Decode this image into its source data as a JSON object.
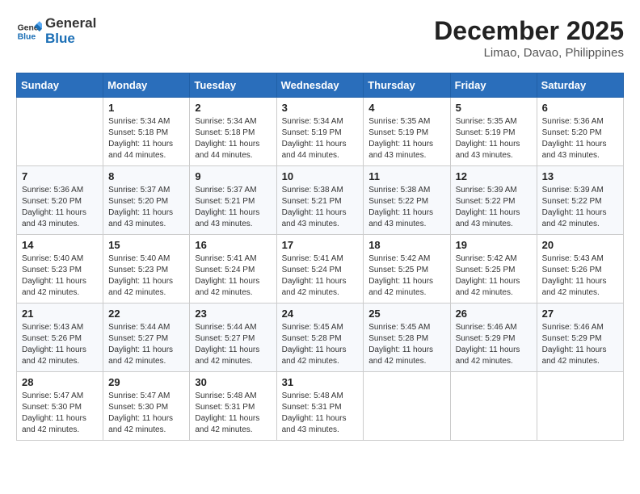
{
  "header": {
    "logo_general": "General",
    "logo_blue": "Blue",
    "month": "December 2025",
    "location": "Limao, Davao, Philippines"
  },
  "days_of_week": [
    "Sunday",
    "Monday",
    "Tuesday",
    "Wednesday",
    "Thursday",
    "Friday",
    "Saturday"
  ],
  "weeks": [
    [
      {
        "day": "",
        "info": ""
      },
      {
        "day": "1",
        "info": "Sunrise: 5:34 AM\nSunset: 5:18 PM\nDaylight: 11 hours\nand 44 minutes."
      },
      {
        "day": "2",
        "info": "Sunrise: 5:34 AM\nSunset: 5:18 PM\nDaylight: 11 hours\nand 44 minutes."
      },
      {
        "day": "3",
        "info": "Sunrise: 5:34 AM\nSunset: 5:19 PM\nDaylight: 11 hours\nand 44 minutes."
      },
      {
        "day": "4",
        "info": "Sunrise: 5:35 AM\nSunset: 5:19 PM\nDaylight: 11 hours\nand 43 minutes."
      },
      {
        "day": "5",
        "info": "Sunrise: 5:35 AM\nSunset: 5:19 PM\nDaylight: 11 hours\nand 43 minutes."
      },
      {
        "day": "6",
        "info": "Sunrise: 5:36 AM\nSunset: 5:20 PM\nDaylight: 11 hours\nand 43 minutes."
      }
    ],
    [
      {
        "day": "7",
        "info": "Sunrise: 5:36 AM\nSunset: 5:20 PM\nDaylight: 11 hours\nand 43 minutes."
      },
      {
        "day": "8",
        "info": "Sunrise: 5:37 AM\nSunset: 5:20 PM\nDaylight: 11 hours\nand 43 minutes."
      },
      {
        "day": "9",
        "info": "Sunrise: 5:37 AM\nSunset: 5:21 PM\nDaylight: 11 hours\nand 43 minutes."
      },
      {
        "day": "10",
        "info": "Sunrise: 5:38 AM\nSunset: 5:21 PM\nDaylight: 11 hours\nand 43 minutes."
      },
      {
        "day": "11",
        "info": "Sunrise: 5:38 AM\nSunset: 5:22 PM\nDaylight: 11 hours\nand 43 minutes."
      },
      {
        "day": "12",
        "info": "Sunrise: 5:39 AM\nSunset: 5:22 PM\nDaylight: 11 hours\nand 43 minutes."
      },
      {
        "day": "13",
        "info": "Sunrise: 5:39 AM\nSunset: 5:22 PM\nDaylight: 11 hours\nand 42 minutes."
      }
    ],
    [
      {
        "day": "14",
        "info": "Sunrise: 5:40 AM\nSunset: 5:23 PM\nDaylight: 11 hours\nand 42 minutes."
      },
      {
        "day": "15",
        "info": "Sunrise: 5:40 AM\nSunset: 5:23 PM\nDaylight: 11 hours\nand 42 minutes."
      },
      {
        "day": "16",
        "info": "Sunrise: 5:41 AM\nSunset: 5:24 PM\nDaylight: 11 hours\nand 42 minutes."
      },
      {
        "day": "17",
        "info": "Sunrise: 5:41 AM\nSunset: 5:24 PM\nDaylight: 11 hours\nand 42 minutes."
      },
      {
        "day": "18",
        "info": "Sunrise: 5:42 AM\nSunset: 5:25 PM\nDaylight: 11 hours\nand 42 minutes."
      },
      {
        "day": "19",
        "info": "Sunrise: 5:42 AM\nSunset: 5:25 PM\nDaylight: 11 hours\nand 42 minutes."
      },
      {
        "day": "20",
        "info": "Sunrise: 5:43 AM\nSunset: 5:26 PM\nDaylight: 11 hours\nand 42 minutes."
      }
    ],
    [
      {
        "day": "21",
        "info": "Sunrise: 5:43 AM\nSunset: 5:26 PM\nDaylight: 11 hours\nand 42 minutes."
      },
      {
        "day": "22",
        "info": "Sunrise: 5:44 AM\nSunset: 5:27 PM\nDaylight: 11 hours\nand 42 minutes."
      },
      {
        "day": "23",
        "info": "Sunrise: 5:44 AM\nSunset: 5:27 PM\nDaylight: 11 hours\nand 42 minutes."
      },
      {
        "day": "24",
        "info": "Sunrise: 5:45 AM\nSunset: 5:28 PM\nDaylight: 11 hours\nand 42 minutes."
      },
      {
        "day": "25",
        "info": "Sunrise: 5:45 AM\nSunset: 5:28 PM\nDaylight: 11 hours\nand 42 minutes."
      },
      {
        "day": "26",
        "info": "Sunrise: 5:46 AM\nSunset: 5:29 PM\nDaylight: 11 hours\nand 42 minutes."
      },
      {
        "day": "27",
        "info": "Sunrise: 5:46 AM\nSunset: 5:29 PM\nDaylight: 11 hours\nand 42 minutes."
      }
    ],
    [
      {
        "day": "28",
        "info": "Sunrise: 5:47 AM\nSunset: 5:30 PM\nDaylight: 11 hours\nand 42 minutes."
      },
      {
        "day": "29",
        "info": "Sunrise: 5:47 AM\nSunset: 5:30 PM\nDaylight: 11 hours\nand 42 minutes."
      },
      {
        "day": "30",
        "info": "Sunrise: 5:48 AM\nSunset: 5:31 PM\nDaylight: 11 hours\nand 42 minutes."
      },
      {
        "day": "31",
        "info": "Sunrise: 5:48 AM\nSunset: 5:31 PM\nDaylight: 11 hours\nand 43 minutes."
      },
      {
        "day": "",
        "info": ""
      },
      {
        "day": "",
        "info": ""
      },
      {
        "day": "",
        "info": ""
      }
    ]
  ]
}
